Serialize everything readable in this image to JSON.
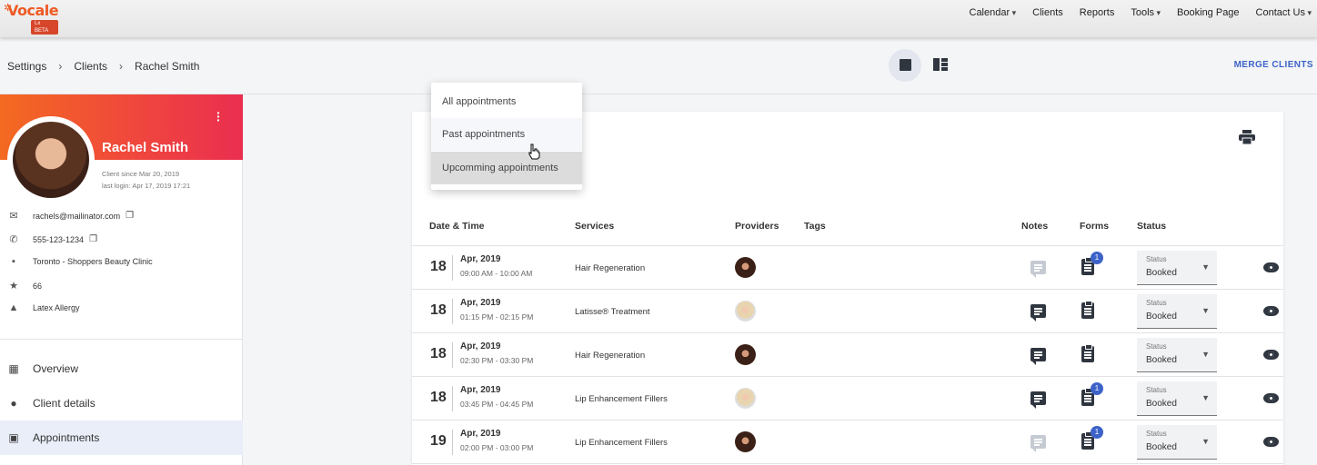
{
  "app": {
    "logo_text": "Vocale",
    "logo_badge": "Lx BETA"
  },
  "topnav": {
    "items": [
      "Calendar",
      "Clients",
      "Reports",
      "Tools",
      "Booking Page",
      "Contact Us"
    ]
  },
  "breadcrumb": [
    "Settings",
    "Clients",
    "Rachel Smith"
  ],
  "header": {
    "merge_label": "MERGE CLIENTS"
  },
  "client": {
    "name": "Rachel Smith",
    "since": "Client since Mar 20, 2019",
    "last_login": "last login: Apr 17, 2019 17:21",
    "email": "rachels@mailinator.com",
    "phone": "555-123-1234",
    "location": "Toronto - Shoppers Beauty Clinic",
    "points": "66",
    "alert": "Latex Allergy"
  },
  "sidebar": {
    "items": [
      {
        "label": "Overview",
        "icon": "dashboard-icon"
      },
      {
        "label": "Client details",
        "icon": "person-icon"
      },
      {
        "label": "Appointments",
        "icon": "calendar-icon"
      }
    ],
    "active": "Appointments"
  },
  "filter_dropdown": {
    "options": [
      "All appointments",
      "Past appointments",
      "Upcomming appointments"
    ],
    "hovered": "Past appointments",
    "selected": "Upcomming appointments"
  },
  "table": {
    "columns": [
      "Date & Time",
      "Services",
      "Providers",
      "Tags",
      "Notes",
      "Forms",
      "Status"
    ],
    "status_label": "Status",
    "rows": [
      {
        "day": "18",
        "month": "Apr, 2019",
        "time": "09:00 AM - 10:00 AM",
        "service": "Hair Regeneration",
        "provider": "dark",
        "has_note": false,
        "form_badge": "1",
        "status": "Booked"
      },
      {
        "day": "18",
        "month": "Apr, 2019",
        "time": "01:15 PM - 02:15 PM",
        "service": "Latisse® Treatment",
        "provider": "light",
        "has_note": true,
        "form_badge": "",
        "status": "Booked"
      },
      {
        "day": "18",
        "month": "Apr, 2019",
        "time": "02:30 PM - 03:30 PM",
        "service": "Hair Regeneration",
        "provider": "dark",
        "has_note": true,
        "form_badge": "",
        "status": "Booked"
      },
      {
        "day": "18",
        "month": "Apr, 2019",
        "time": "03:45 PM - 04:45 PM",
        "service": "Lip Enhancement Fillers",
        "provider": "light",
        "has_note": true,
        "form_badge": "1",
        "status": "Booked"
      },
      {
        "day": "19",
        "month": "Apr, 2019",
        "time": "02:00 PM - 03:00 PM",
        "service": "Lip Enhancement Fillers",
        "provider": "dark",
        "has_note": false,
        "form_badge": "1",
        "status": "Booked"
      }
    ]
  },
  "colors": {
    "accent": "#3d63c9",
    "header_gradient_start": "#f36a20",
    "header_gradient_end": "#ea2e50"
  }
}
